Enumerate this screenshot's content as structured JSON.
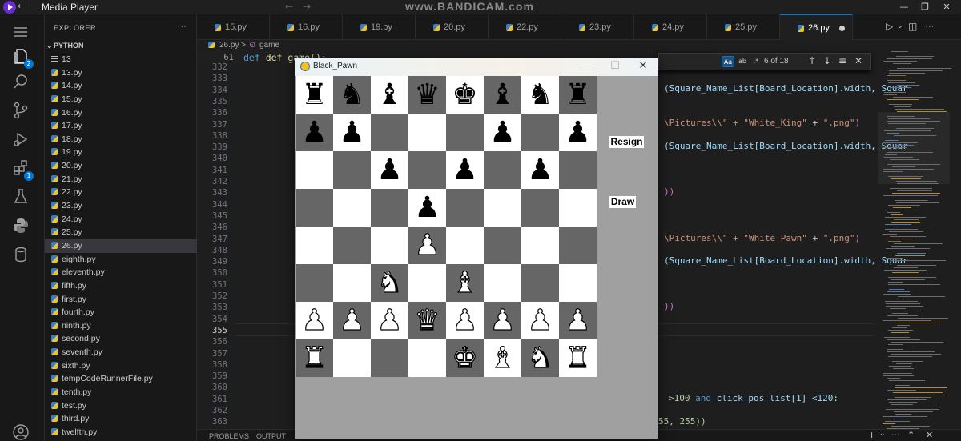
{
  "media_player": {
    "title": "Media Player",
    "back_glyph": "⟵",
    "watermark": "www.BANDICAM.com",
    "controls": [
      "—",
      "❐",
      "✕"
    ]
  },
  "explorer": {
    "title": "EXPLORER",
    "more": "···",
    "section": "PYTHON",
    "files": [
      {
        "name": "13",
        "type": "txt"
      },
      {
        "name": "13.py",
        "type": "py"
      },
      {
        "name": "14.py",
        "type": "py"
      },
      {
        "name": "15.py",
        "type": "py"
      },
      {
        "name": "16.py",
        "type": "py"
      },
      {
        "name": "17.py",
        "type": "py"
      },
      {
        "name": "18.py",
        "type": "py"
      },
      {
        "name": "19.py",
        "type": "py"
      },
      {
        "name": "20.py",
        "type": "py"
      },
      {
        "name": "21.py",
        "type": "py"
      },
      {
        "name": "22.py",
        "type": "py"
      },
      {
        "name": "23.py",
        "type": "py"
      },
      {
        "name": "24.py",
        "type": "py"
      },
      {
        "name": "25.py",
        "type": "py"
      },
      {
        "name": "26.py",
        "type": "py",
        "active": true
      },
      {
        "name": "eighth.py",
        "type": "py"
      },
      {
        "name": "eleventh.py",
        "type": "py"
      },
      {
        "name": "fifth.py",
        "type": "py"
      },
      {
        "name": "first.py",
        "type": "py"
      },
      {
        "name": "fourth.py",
        "type": "py"
      },
      {
        "name": "ninth.py",
        "type": "py"
      },
      {
        "name": "second.py",
        "type": "py"
      },
      {
        "name": "seventh.py",
        "type": "py"
      },
      {
        "name": "sixth.py",
        "type": "py"
      },
      {
        "name": "tempCodeRunnerFile.py",
        "type": "py"
      },
      {
        "name": "tenth.py",
        "type": "py"
      },
      {
        "name": "test.py",
        "type": "py"
      },
      {
        "name": "third.py",
        "type": "py"
      },
      {
        "name": "twelfth.py",
        "type": "py"
      }
    ]
  },
  "activity_badges": {
    "source_control": "2",
    "extensions": "1"
  },
  "tabs": [
    {
      "label": "15.py"
    },
    {
      "label": "16.py"
    },
    {
      "label": "19.py"
    },
    {
      "label": "20.py"
    },
    {
      "label": "22.py"
    },
    {
      "label": "23.py"
    },
    {
      "label": "24.py"
    },
    {
      "label": "25.py"
    },
    {
      "label": "26.py",
      "active": true,
      "modified": true
    }
  ],
  "breadcrumb": {
    "file": "26.py",
    "separator": ">",
    "symbol": "game"
  },
  "sticky": {
    "line": "61",
    "code": "def game():"
  },
  "line_numbers": [
    "332",
    "333",
    "334",
    "335",
    "336",
    "337",
    "338",
    "339",
    "340",
    "341",
    "342",
    "343",
    "344",
    "345",
    "346",
    "347",
    "348",
    "349",
    "350",
    "351",
    "352",
    "353",
    "354",
    "355",
    "356",
    "357",
    "358",
    "359",
    "360",
    "361",
    "362",
    "363"
  ],
  "current_line": "355",
  "code_fragments": {
    "l334": "(Square_Name_List[Board_Location].width, Squar",
    "l337a": "\\Pictures\\\\\" + ",
    "l337b": "\"White_King\"",
    "l337c": " + ",
    "l337d": "\".png\"",
    "l337e": ")",
    "l339": "(Square_Name_List[Board_Location].width, Squar",
    "l343": "))",
    "l347a": "\\Pictures\\\\\" + ",
    "l347b": "\"White_Pawn\"",
    "l347c": " + ",
    "l347d": "\".png\"",
    "l347e": ")",
    "l349": "(Square_Name_List[Board_Location].width, Squar",
    "l353": "))",
    "l361a": ">100 ",
    "l361b": "and",
    "l361c": " click_pos_list[1] <120:",
    "l363": "55, 255))"
  },
  "find": {
    "match_case": "Aa",
    "whole_word": "ab",
    "regex": ".*",
    "count": "6 of 18",
    "prev": "↑",
    "next": "↓",
    "selection": "≡",
    "close": "✕"
  },
  "panel_tabs": [
    "PROBLEMS",
    "OUTPUT"
  ],
  "game_window": {
    "title": "Black_Pawn",
    "min": "—",
    "max": "☐",
    "close": "✕",
    "resign_label": "Resign",
    "draw_label": "Draw",
    "board": [
      [
        "bR",
        "bN",
        "bB",
        "bQ",
        "bK",
        "bB",
        "bN",
        "bR"
      ],
      [
        "bP",
        "bP",
        "",
        "",
        "",
        "bP",
        "",
        "bP"
      ],
      [
        "",
        "",
        "bP",
        "",
        "bP",
        "",
        "bP",
        ""
      ],
      [
        "",
        "",
        "",
        "bP",
        "",
        "",
        "",
        ""
      ],
      [
        "",
        "",
        "",
        "wP",
        "",
        "",
        "",
        ""
      ],
      [
        "",
        "",
        "wN",
        "",
        "wB",
        "",
        "",
        ""
      ],
      [
        "wP",
        "wP",
        "wP",
        "wQ",
        "wP",
        "wP",
        "wP",
        "wP"
      ],
      [
        "wR",
        "",
        "",
        "",
        "wK",
        "wB",
        "wN",
        "wR"
      ]
    ]
  }
}
